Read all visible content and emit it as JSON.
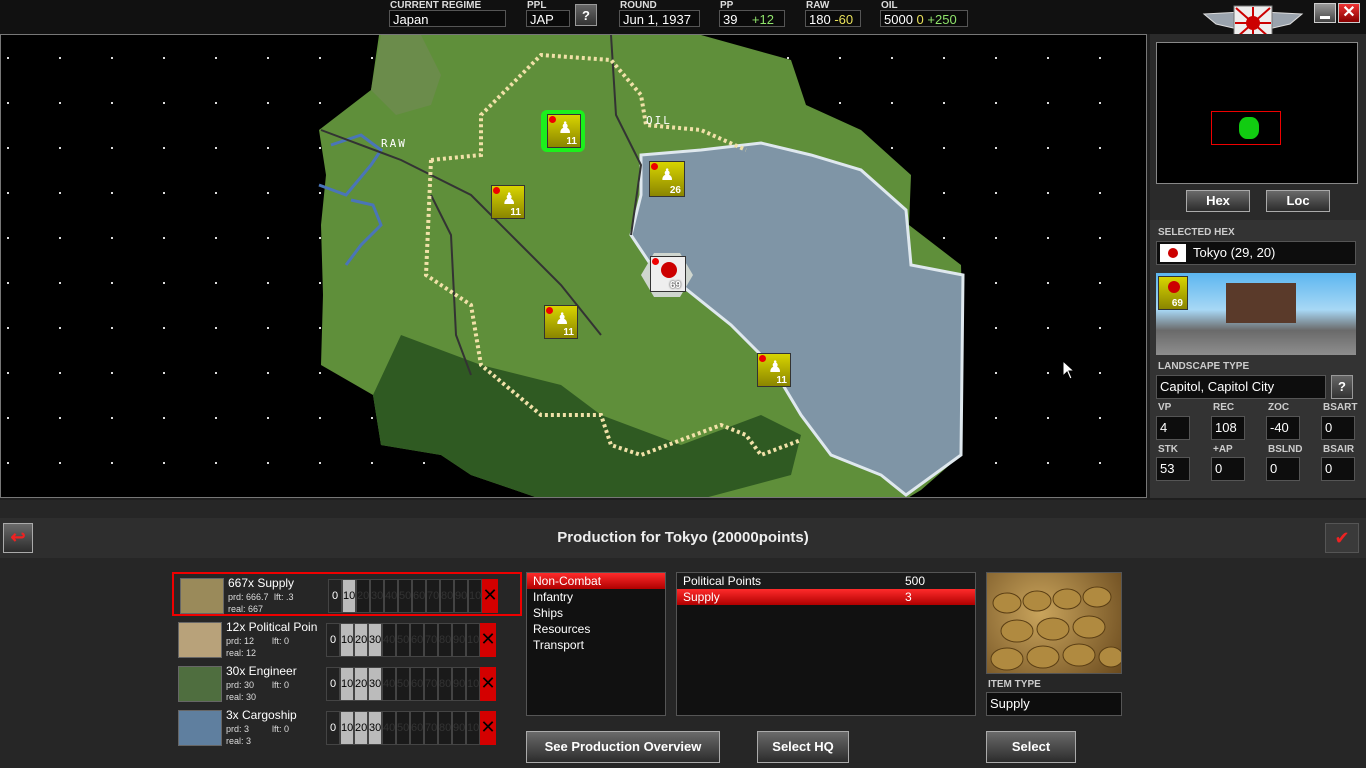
{
  "topbar": {
    "regime_label": "CURRENT REGIME",
    "regime_value": "Japan",
    "ppl_label": "PPL",
    "ppl_value": "JAP",
    "help": "?",
    "round_label": "ROUND",
    "round_value": "Jun 1, 1937",
    "pp_label": "PP",
    "pp_value": "39",
    "pp_delta": "+12",
    "raw_label": "RAW",
    "raw_value": "180",
    "raw_delta": "-60",
    "oil_label": "OIL",
    "oil_value": "5000",
    "oil_mid": "0",
    "oil_delta": "+250"
  },
  "map": {
    "labels": {
      "raw": "RAW",
      "oil": "OIL"
    },
    "units": [
      {
        "strength": "11"
      },
      {
        "strength": "26"
      },
      {
        "strength": "11"
      },
      {
        "strength": "69"
      },
      {
        "strength": "11"
      },
      {
        "strength": "11"
      }
    ]
  },
  "right_panel": {
    "hex_button": "Hex",
    "loc_button": "Loc",
    "selected_hex_label": "SELECTED HEX",
    "selected_hex_value": "Tokyo (29, 20)",
    "city_strength": "69",
    "landscape_label": "LANDSCAPE TYPE",
    "landscape_value": "Capitol, Capitol City",
    "help": "?",
    "stats": [
      {
        "label": "VP",
        "value": "4"
      },
      {
        "label": "REC",
        "value": "108"
      },
      {
        "label": "ZOC",
        "value": "-40"
      },
      {
        "label": "BSART",
        "value": "0"
      },
      {
        "label": "STK",
        "value": "53"
      },
      {
        "label": "+AP",
        "value": "0"
      },
      {
        "label": "BSLND",
        "value": "0"
      },
      {
        "label": "BSAIR",
        "value": "0"
      }
    ]
  },
  "production": {
    "title": "Production for Tokyo (20000points)",
    "rows": [
      {
        "name": "667x Supply",
        "prd": "prd: 666.7",
        "lft": "lft: .3",
        "real": "real: 667",
        "level": 1
      },
      {
        "name": "12x Political Poin",
        "prd": "prd: 12",
        "lft": "lft: 0",
        "real": "real: 12",
        "level": 3
      },
      {
        "name": "30x Engineer",
        "prd": "prd: 30",
        "lft": "lft: 0",
        "real": "real: 30",
        "level": 3
      },
      {
        "name": "3x Cargoship",
        "prd": "prd: 3",
        "lft": "lft: 0",
        "real": "real: 3",
        "level": 3
      }
    ],
    "slots": [
      "0",
      "10",
      "20",
      "30",
      "40",
      "50",
      "60",
      "70",
      "80",
      "90",
      "100"
    ],
    "categories": [
      "Non-Combat",
      "Infantry",
      "Ships",
      "Resources",
      "Transport"
    ],
    "items": [
      {
        "name": "Political Points",
        "cost": "500"
      },
      {
        "name": "Supply",
        "cost": "3"
      }
    ],
    "item_type_label": "ITEM TYPE",
    "item_type_value": "Supply",
    "overview_button": "See Production Overview",
    "select_hq_button": "Select HQ",
    "select_button": "Select"
  }
}
